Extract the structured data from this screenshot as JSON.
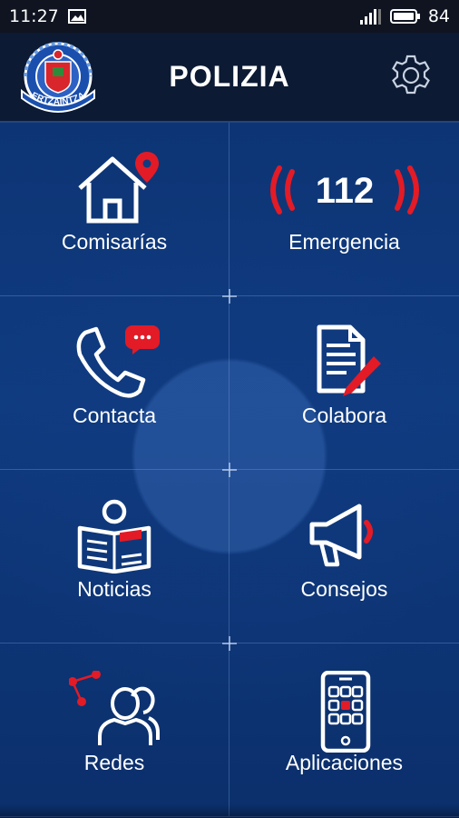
{
  "status_bar": {
    "time": "11:27",
    "battery": "84",
    "icons": [
      "image-icon",
      "signal-icon",
      "battery-icon"
    ]
  },
  "header": {
    "title": "POLIZIA",
    "logo_text": "ERTZAINTZA",
    "settings_icon": "gear-icon"
  },
  "tiles": [
    {
      "label": "Comisarías",
      "icon": "police-station-location-icon"
    },
    {
      "label": "Emergencia",
      "icon": "emergency-112-icon",
      "icon_text": "112"
    },
    {
      "label": "Contacta",
      "icon": "phone-chat-icon"
    },
    {
      "label": "Colabora",
      "icon": "document-pen-icon"
    },
    {
      "label": "Noticias",
      "icon": "newspaper-reader-icon"
    },
    {
      "label": "Consejos",
      "icon": "megaphone-icon"
    },
    {
      "label": "Redes",
      "icon": "social-network-icon"
    },
    {
      "label": "Aplicaciones",
      "icon": "apps-phone-icon"
    }
  ],
  "colors": {
    "accent_red": "#e21b26",
    "header_bg": "#0c1a33",
    "grid_bg": "#0f3b80"
  }
}
